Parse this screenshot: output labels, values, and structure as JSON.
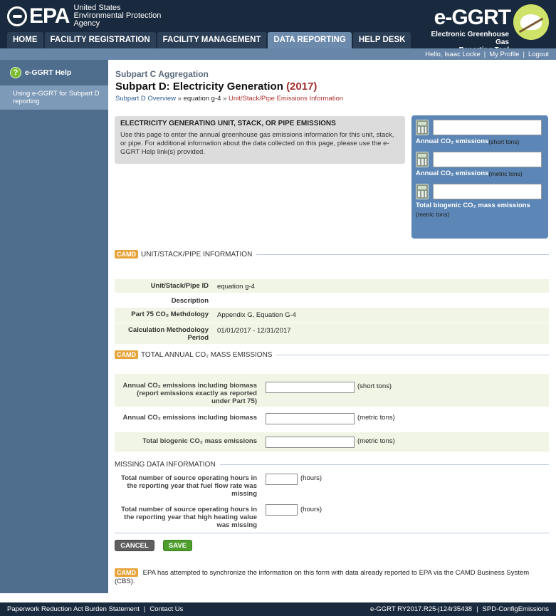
{
  "header": {
    "epa_word": "EPA",
    "agency_lines": [
      "United States",
      "Environmental Protection",
      "Agency"
    ],
    "ggrt_title": "e-GGRT",
    "ggrt_sub": [
      "Electronic Greenhouse Gas",
      "Reporting Tool"
    ]
  },
  "tabs": [
    "HOME",
    "FACILITY REGISTRATION",
    "FACILITY MANAGEMENT",
    "DATA REPORTING",
    "HELP DESK"
  ],
  "userbar": {
    "greeting": "Hello, Isaac Locke",
    "profile": "My Profile",
    "logout": "Logout"
  },
  "sidebar": {
    "help_title": "e-GGRT Help",
    "help_link": "Using e-GGRT for Subpart D reporting"
  },
  "main": {
    "subtitle": "Subpart C Aggregation",
    "title": "Subpart D: Electricity Generation",
    "year": "(2017)",
    "crumbs": [
      "Subpart D Overview",
      "equation g-4",
      "Unit/Stack/Pipe Emissions Information"
    ],
    "crumb_sep": "»"
  },
  "info_box": {
    "heading": "ELECTRICITY GENERATING UNIT, STACK, OR PIPE EMISSIONS",
    "text": "Use this page to enter the annual greenhouse gas emissions information for this unit, stack, or pipe. For additional information about the data collected on this page, please use the e-GGRT Help link(s) provided."
  },
  "summary": [
    {
      "label": "Annual CO₂ emissions",
      "unit": "(short tons)"
    },
    {
      "label": "Annual CO₂ emissions",
      "unit": "(metric tons)"
    },
    {
      "label": "Total biogenic CO₂ mass emissions",
      "unit": "(metric tons)"
    }
  ],
  "camd_badge": "CAMD",
  "unit_section": {
    "title": "UNIT/STACK/PIPE INFORMATION",
    "rows": [
      {
        "label": "Unit/Stack/Pipe ID",
        "value": "equation g-4"
      },
      {
        "label": "Description",
        "value": ""
      },
      {
        "label": "Part 75 CO₂ Methdology",
        "value": "Appendix G, Equation G-4"
      },
      {
        "label": "Calculation Methodology Period",
        "value": "01/01/2017 - 12/31/2017"
      }
    ]
  },
  "mass_section": {
    "title": "TOTAL ANNUAL CO₂ MASS EMISSIONS",
    "fields": [
      {
        "label": "Annual CO₂ emissions including biomass (report emissions exactly as reported under Part 75)",
        "unit": "(short tons)",
        "value": ""
      },
      {
        "label": "Annual CO₂ emissions including biomass",
        "unit": "(metric tons)",
        "value": ""
      },
      {
        "label": "Total biogenic CO₂ mass emissions",
        "unit": "(metric tons)",
        "value": ""
      }
    ]
  },
  "missing_section": {
    "title": "MISSING DATA INFORMATION",
    "fields": [
      {
        "label": "Total number of source operating hours in the reporting year that fuel flow rate was missing",
        "unit": "(hours)",
        "value": ""
      },
      {
        "label": "Total number of source operating hours in the reporting year that high heating value was missing",
        "unit": "(hours)",
        "value": ""
      }
    ]
  },
  "buttons": {
    "cancel": "CANCEL",
    "save": "SAVE"
  },
  "sync_note": "EPA has attempted to synchronize the information on this form with data already reported to EPA via the CAMD Business System (CBS).",
  "footer": {
    "paperwork": "Paperwork Reduction Act Burden Statement",
    "contact": "Contact Us",
    "version": "e-GGRT RY2017.R25-j124r35438",
    "page_id": "SPD-ConfigEmissions"
  }
}
